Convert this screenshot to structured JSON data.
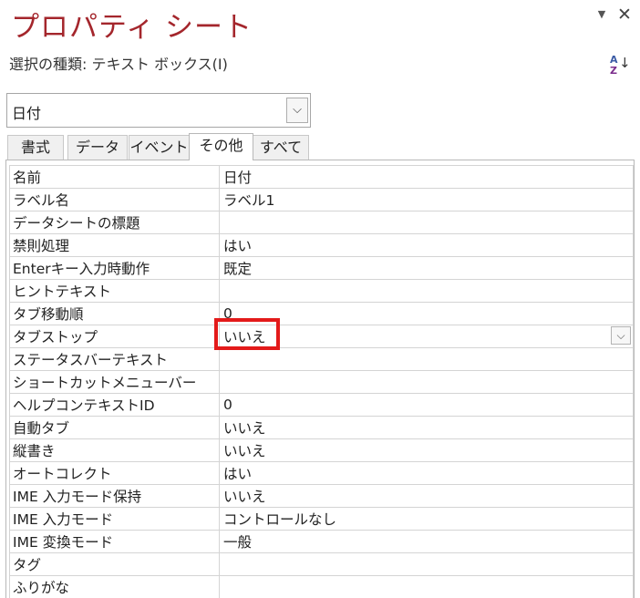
{
  "header": {
    "title": "プロパティ シート",
    "selection_type": "選択の種類:  テキスト ボックス(I)",
    "menu_icon": "chevron-down-icon",
    "close_icon": "close-icon",
    "sort_icon": "sort-az-icon",
    "sort_a": "A",
    "sort_z": "Z"
  },
  "object_combo": {
    "value": "日付"
  },
  "tabs": [
    {
      "label": "書式",
      "active": false
    },
    {
      "label": "データ",
      "active": false
    },
    {
      "label": "イベント",
      "active": false
    },
    {
      "label": "その他",
      "active": true
    },
    {
      "label": "すべて",
      "active": false
    }
  ],
  "properties": [
    {
      "name": "名前",
      "value": "日付"
    },
    {
      "name": "ラベル名",
      "value": "ラベル1"
    },
    {
      "name": "データシートの標題",
      "value": ""
    },
    {
      "name": "禁則処理",
      "value": "はい"
    },
    {
      "name": "Enterキー入力時動作",
      "value": "既定"
    },
    {
      "name": "ヒントテキスト",
      "value": ""
    },
    {
      "name": "タブ移動順",
      "value": "0"
    },
    {
      "name": "タブストップ",
      "value": "いいえ",
      "has_dropdown": true,
      "highlighted": true
    },
    {
      "name": "ステータスバーテキスト",
      "value": ""
    },
    {
      "name": "ショートカットメニューバー",
      "value": ""
    },
    {
      "name": "ヘルプコンテキストID",
      "value": "0"
    },
    {
      "name": "自動タブ",
      "value": "いいえ"
    },
    {
      "name": "縦書き",
      "value": "いいえ"
    },
    {
      "name": "オートコレクト",
      "value": "はい"
    },
    {
      "name": "IME 入力モード保持",
      "value": "いいえ"
    },
    {
      "name": "IME 入力モード",
      "value": "コントロールなし"
    },
    {
      "name": "IME 変換モード",
      "value": "一般"
    },
    {
      "name": "タグ",
      "value": ""
    },
    {
      "name": "ふりがな",
      "value": ""
    }
  ],
  "colors": {
    "title": "#a4262c",
    "highlight_border": "#e31a1a"
  }
}
